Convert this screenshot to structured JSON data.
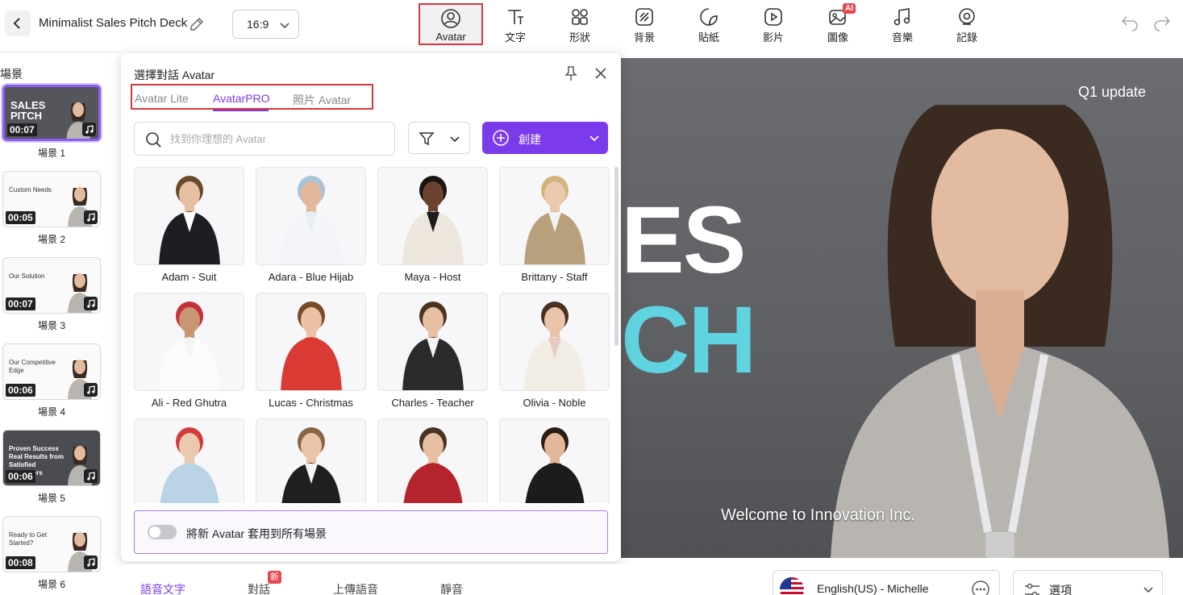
{
  "header": {
    "project_title": "Minimalist Sales Pitch Deck",
    "aspect_ratio": "16:9"
  },
  "toolbar": {
    "items": [
      {
        "label": "Avatar",
        "icon": "avatar-icon",
        "active": true
      },
      {
        "label": "文字",
        "icon": "text-icon"
      },
      {
        "label": "形狀",
        "icon": "shapes-icon"
      },
      {
        "label": "背景",
        "icon": "background-icon"
      },
      {
        "label": "貼紙",
        "icon": "sticker-icon"
      },
      {
        "label": "影片",
        "icon": "video-icon"
      },
      {
        "label": "圖像",
        "icon": "image-icon",
        "badge": "AI"
      },
      {
        "label": "音樂",
        "icon": "music-icon"
      },
      {
        "label": "記錄",
        "icon": "record-icon"
      }
    ]
  },
  "scenes": {
    "heading": "場景",
    "items": [
      {
        "label": "場景 1",
        "duration": "00:07",
        "title": "SALES PITCH"
      },
      {
        "label": "場景 2",
        "duration": "00:05",
        "title": "Custom Needs"
      },
      {
        "label": "場景 3",
        "duration": "00:07",
        "title": "Our Solution"
      },
      {
        "label": "場景 4",
        "duration": "00:06",
        "title": "Our Competitive Edge"
      },
      {
        "label": "場景 5",
        "duration": "00:06",
        "title": "Proven Success Real Results from Satisfied Customers"
      },
      {
        "label": "場景 6",
        "duration": "00:08",
        "title": "Ready to Get Started?"
      }
    ]
  },
  "popup": {
    "title": "選擇對話 Avatar",
    "tabs": [
      {
        "label": "Avatar Lite"
      },
      {
        "label": "AvatarPRO",
        "active": true
      },
      {
        "label": "照片 Avatar"
      }
    ],
    "search_placeholder": "找到你理想的 Avatar",
    "create_label": "創建",
    "avatars": [
      {
        "name": "Adam - Suit",
        "outfit": "#1e1e22",
        "shirt": "#ffffff",
        "skin": "#e6bfa3",
        "hair": "#6b4a2b"
      },
      {
        "name": "Adara - Blue Hijab",
        "outfit": "#f3f5f8",
        "shirt": "#e9eef4",
        "skin": "#e3b79a",
        "hair": "#a9c3db"
      },
      {
        "name": "Maya - Host",
        "outfit": "#ece6dc",
        "shirt": "#1c1c1e",
        "skin": "#6b4330",
        "hair": "#1a1412"
      },
      {
        "name": "Brittany - Staff",
        "outfit": "#b9a07c",
        "shirt": "#f3f3f3",
        "skin": "#ecc8ae",
        "hair": "#d2b37c"
      },
      {
        "name": "Ali - Red Ghutra",
        "outfit": "#fbfbfb",
        "shirt": "#f4f4f4",
        "skin": "#c99674",
        "hair": "#c7303a"
      },
      {
        "name": "Lucas - Christmas",
        "outfit": "#d93a33",
        "shirt": "#d93a33",
        "skin": "#ecc2a4",
        "hair": "#7a4b2a"
      },
      {
        "name": "Charles - Teacher",
        "outfit": "#2b2b2e",
        "shirt": "#f5f5f5",
        "skin": "#e6bfa3",
        "hair": "#4a3322"
      },
      {
        "name": "Olivia - Noble",
        "outfit": "#f2ede4",
        "shirt": "#e7c9c2",
        "skin": "#eac3a8",
        "hair": "#4a3022"
      },
      {
        "name": "",
        "outfit": "#b9d4e6",
        "shirt": "#b9d4e6",
        "skin": "#ecc8ae",
        "hair": "#d13b3b"
      },
      {
        "name": "",
        "outfit": "#1f1f22",
        "shirt": "#f5f5f5",
        "skin": "#eac3a8",
        "hair": "#8a6445"
      },
      {
        "name": "",
        "outfit": "#b5232d",
        "shirt": "#b5232d",
        "skin": "#e6bfa3",
        "hair": "#4a3322"
      },
      {
        "name": "",
        "outfit": "#1c1c1e",
        "shirt": "#1c1c1e",
        "skin": "#e3b79a",
        "hair": "#2b1c14"
      }
    ],
    "apply_all_label": "將新 Avatar 套用到所有場景"
  },
  "canvas": {
    "tag": "Q1 update",
    "line1": "ES",
    "line2": "CH",
    "subtitle": "Welcome to Innovation Inc.",
    "accent_color": "#5fd3e0"
  },
  "bottom": {
    "tabs": [
      {
        "label": "語音文字",
        "active": true
      },
      {
        "label": "對話",
        "badge": "新"
      },
      {
        "label": "上傳語音"
      },
      {
        "label": "靜音"
      }
    ],
    "voice": "English(US) - Michelle",
    "options_label": "選項"
  }
}
